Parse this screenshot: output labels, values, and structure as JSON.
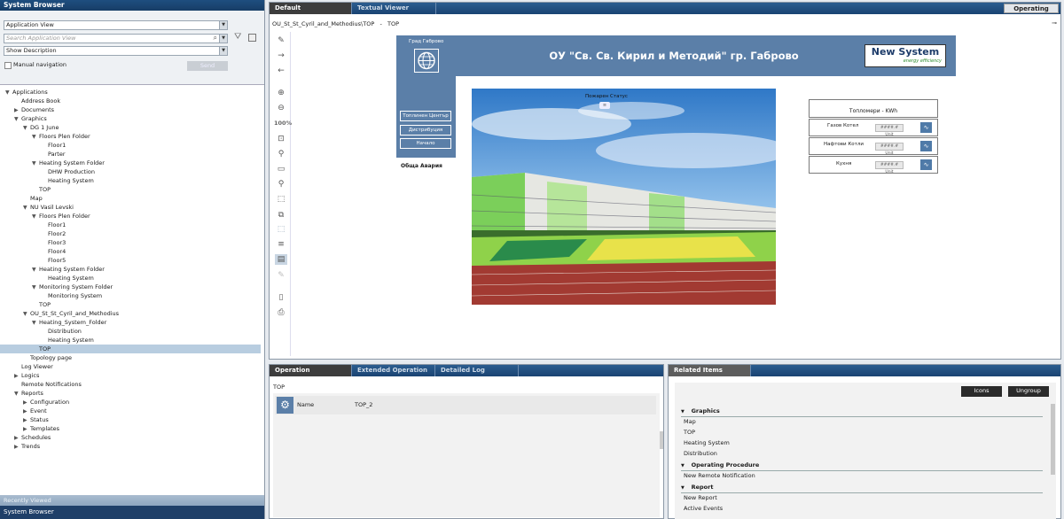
{
  "left": {
    "title": "System Browser",
    "view_select": "Application View",
    "search_placeholder": "Search Application View",
    "desc_select": "Show Description",
    "manual_nav": "Manual navigation",
    "send": "Send",
    "tree": [
      {
        "label": "Applications",
        "depth": 0,
        "tw": "▼"
      },
      {
        "label": "Address Book",
        "depth": 1,
        "tw": ""
      },
      {
        "label": "Documents",
        "depth": 1,
        "tw": "▶"
      },
      {
        "label": "Graphics",
        "depth": 1,
        "tw": "▼"
      },
      {
        "label": "DG 1 June",
        "depth": 2,
        "tw": "▼"
      },
      {
        "label": "Floors Plen Folder",
        "depth": 3,
        "tw": "▼"
      },
      {
        "label": "Floor1",
        "depth": 4,
        "tw": ""
      },
      {
        "label": "Parter",
        "depth": 4,
        "tw": ""
      },
      {
        "label": "Heating System Folder",
        "depth": 3,
        "tw": "▼"
      },
      {
        "label": "DHW Production",
        "depth": 4,
        "tw": ""
      },
      {
        "label": "Heating System",
        "depth": 4,
        "tw": ""
      },
      {
        "label": "TOP",
        "depth": 3,
        "tw": ""
      },
      {
        "label": "Map",
        "depth": 2,
        "tw": ""
      },
      {
        "label": "NU Vasil Levski",
        "depth": 2,
        "tw": "▼"
      },
      {
        "label": "Floors Plen Folder",
        "depth": 3,
        "tw": "▼"
      },
      {
        "label": "Floor1",
        "depth": 4,
        "tw": ""
      },
      {
        "label": "Floor2",
        "depth": 4,
        "tw": ""
      },
      {
        "label": "Floor3",
        "depth": 4,
        "tw": ""
      },
      {
        "label": "Floor4",
        "depth": 4,
        "tw": ""
      },
      {
        "label": "Floor5",
        "depth": 4,
        "tw": ""
      },
      {
        "label": "Heating System Folder",
        "depth": 3,
        "tw": "▼"
      },
      {
        "label": "Heating System",
        "depth": 4,
        "tw": ""
      },
      {
        "label": "Monitoring System Folder",
        "depth": 3,
        "tw": "▼"
      },
      {
        "label": "Monitoring System",
        "depth": 4,
        "tw": ""
      },
      {
        "label": "TOP",
        "depth": 3,
        "tw": ""
      },
      {
        "label": "OU_St_St_Cyril_and_Methodius",
        "depth": 2,
        "tw": "▼"
      },
      {
        "label": "Heating_System_Folder",
        "depth": 3,
        "tw": "▼"
      },
      {
        "label": "Distribution",
        "depth": 4,
        "tw": ""
      },
      {
        "label": "Heating System",
        "depth": 4,
        "tw": ""
      },
      {
        "label": "TOP",
        "depth": 3,
        "tw": "",
        "selected": true
      },
      {
        "label": "Topology page",
        "depth": 2,
        "tw": ""
      },
      {
        "label": "Log Viewer",
        "depth": 1,
        "tw": ""
      },
      {
        "label": "Logics",
        "depth": 1,
        "tw": "▶"
      },
      {
        "label": "Remote Notifications",
        "depth": 1,
        "tw": ""
      },
      {
        "label": "Reports",
        "depth": 1,
        "tw": "▼"
      },
      {
        "label": "Configuration",
        "depth": 2,
        "tw": "▶"
      },
      {
        "label": "Event",
        "depth": 2,
        "tw": "▶"
      },
      {
        "label": "Status",
        "depth": 2,
        "tw": "▶"
      },
      {
        "label": "Templates",
        "depth": 2,
        "tw": "▶"
      },
      {
        "label": "Schedules",
        "depth": 1,
        "tw": "▶"
      },
      {
        "label": "Trends",
        "depth": 1,
        "tw": "▶"
      }
    ],
    "recent": "Recently Viewed",
    "bottom": "System Browser"
  },
  "main": {
    "tabs": [
      "Default",
      "Textual Viewer"
    ],
    "mode": "Operating",
    "breadcrumb": "OU_St_St_Cyril_and_Methodius\\TOP   -   TOP",
    "zoom": "100%",
    "graphic": {
      "city_label": "Град Габрово",
      "title": "ОУ \"Св. Св. Кирил и Методий\" гр. Габрово",
      "logo_main": "New System",
      "logo_sub": "energy efficiency",
      "btns": [
        "Топлинен Център",
        "Дистрибуция",
        "Начало"
      ],
      "alarm": "Обща Авария",
      "fire_status": "Пожарен Статус",
      "meters_title": "Топломери - KWh",
      "meters": [
        "Газов Котел",
        "Нафтови Котли",
        "Кухня"
      ],
      "meter_val": "####.# Unit"
    }
  },
  "op": {
    "tabs": [
      "Operation",
      "Extended Operation",
      "Detailed Log"
    ],
    "path": "TOP",
    "name_label": "Name",
    "name_value": "TOP_2"
  },
  "rel": {
    "tab": "Related Items",
    "icons": "Icons",
    "ungroup": "Ungroup",
    "groups": [
      {
        "title": "Graphics",
        "items": [
          "Map",
          "TOP",
          "Heating System",
          "Distribution"
        ]
      },
      {
        "title": "Operating Procedure",
        "items": [
          "New Remote Notification"
        ]
      },
      {
        "title": "Report",
        "items": [
          "New Report",
          "Active Events"
        ]
      }
    ]
  }
}
